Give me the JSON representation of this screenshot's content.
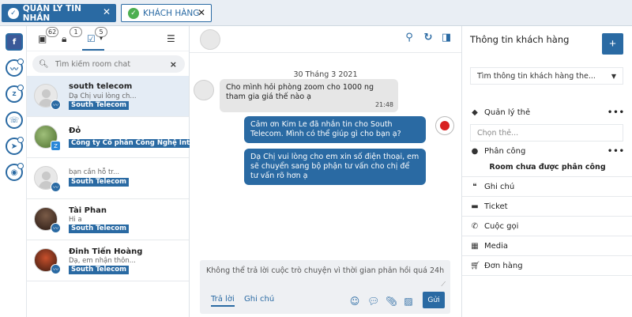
{
  "tabs": [
    {
      "label": "QUẢN LÝ TIN NHẮN"
    },
    {
      "label": "KHÁCH HÀNG"
    }
  ],
  "toolbar": {
    "badges": [
      "62",
      "1",
      "5"
    ]
  },
  "search": {
    "placeholder": "Tìm kiếm room chat"
  },
  "conversations": [
    {
      "name": "south telecom",
      "preview": "Dạ Chị vui lòng ch...",
      "tag": "South Telecom"
    },
    {
      "name": "Đỏ",
      "preview": "",
      "tag": "Công ty Cổ phần Công Nghệ Intelin"
    },
    {
      "name": "",
      "preview": "bạn cần hỗ tr...",
      "tag": "South Telecom"
    },
    {
      "name": "Tài Phan",
      "preview": "Hi a",
      "tag": "South Telecom"
    },
    {
      "name": "Đinh Tiến Hoàng",
      "preview": "Dạ, em nhận thôn...",
      "tag": "South Telecom"
    }
  ],
  "chat": {
    "date": "30 Tháng 3 2021",
    "incoming": {
      "text": "Cho mình hỏi phòng zoom cho 1000 ng tham gia giá thế nào ạ",
      "time": "21:48"
    },
    "outgoing": [
      "Cảm ơn Kim Le đã nhắn tin cho South Telecom. Mình có thể giúp gì cho bạn ạ?",
      "Dạ Chị vui lòng cho em xin số điện thoại, em sẽ chuyển sang bộ phận tư vấn cho chị để tư vấn rõ hơn ạ"
    ],
    "composer_placeholder": "Không thể trả lời cuộc trò chuyện vì thời gian phản hồi quá 24h",
    "reply_tab": "Trả lời",
    "note_tab": "Ghi chú",
    "send_label": "Gửi"
  },
  "info": {
    "title": "Thông tin khách hàng",
    "plus": "+",
    "search_placeholder": "Tìm thông tin khách hàng the...",
    "tag_manage": "Quản lý thẻ",
    "tag_placeholder": "Chọn thẻ...",
    "assign": "Phân công",
    "unassigned": "Room chưa được phân công",
    "notes": "Ghi chú",
    "ticket": "Ticket",
    "calls": "Cuộc gọi",
    "media": "Media",
    "orders": "Đơn hàng"
  },
  "colors": {
    "brand": "#2a6aa3",
    "record": "#d81f1f"
  }
}
